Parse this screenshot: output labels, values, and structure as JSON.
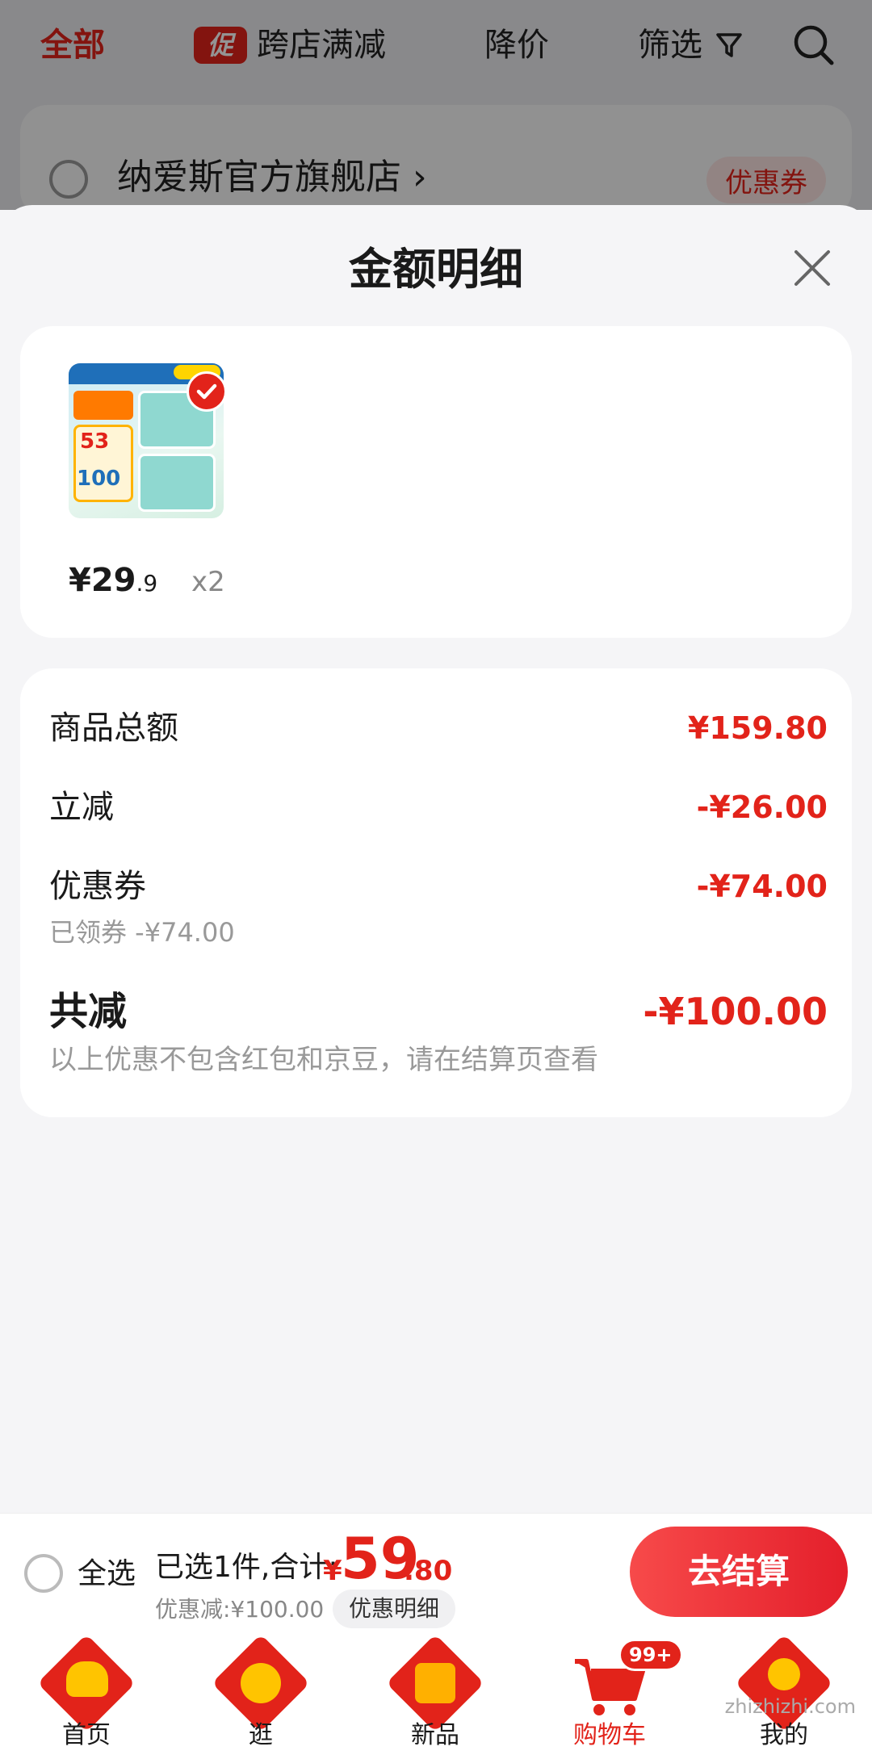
{
  "top_tabs": {
    "all": "全部",
    "promo_badge": "促",
    "promo": "跨店满减",
    "price_drop": "降价",
    "filter": "筛选"
  },
  "store": {
    "name": "纳爱斯官方旗舰店 ›",
    "coupon": "优惠券"
  },
  "sheet": {
    "title": "金额明细",
    "product": {
      "price_int": "¥29",
      "price_dec": ".9",
      "quantity": "x2"
    },
    "rows": {
      "goods_total_label": "商品总额",
      "goods_total_value": "¥159.80",
      "instant_label": "立减",
      "instant_value": "-¥26.00",
      "coupon_label": "优惠券",
      "coupon_value": "-¥74.00",
      "coupon_sub": "已领券 -¥74.00",
      "total_label": "共减",
      "total_value": "-¥100.00",
      "total_note": "以上优惠不包含红包和京豆，请在结算页查看"
    }
  },
  "checkout": {
    "select_all": "全选",
    "selected_text": "已选1件,合计:",
    "currency": "¥",
    "total_int": "59",
    "total_dec": ".80",
    "discount_text": "优惠减:¥100.00",
    "discount_detail": "优惠明细",
    "checkout_button": "去结算"
  },
  "nav": {
    "items": [
      {
        "label": "首页"
      },
      {
        "label": "逛"
      },
      {
        "label": "新品"
      },
      {
        "label": "购物车",
        "badge": "99+"
      },
      {
        "label": "我的"
      }
    ]
  },
  "watermark": "zhizhizhi.com",
  "colors": {
    "accent": "#e2231a",
    "background": "#f5f5f7"
  }
}
